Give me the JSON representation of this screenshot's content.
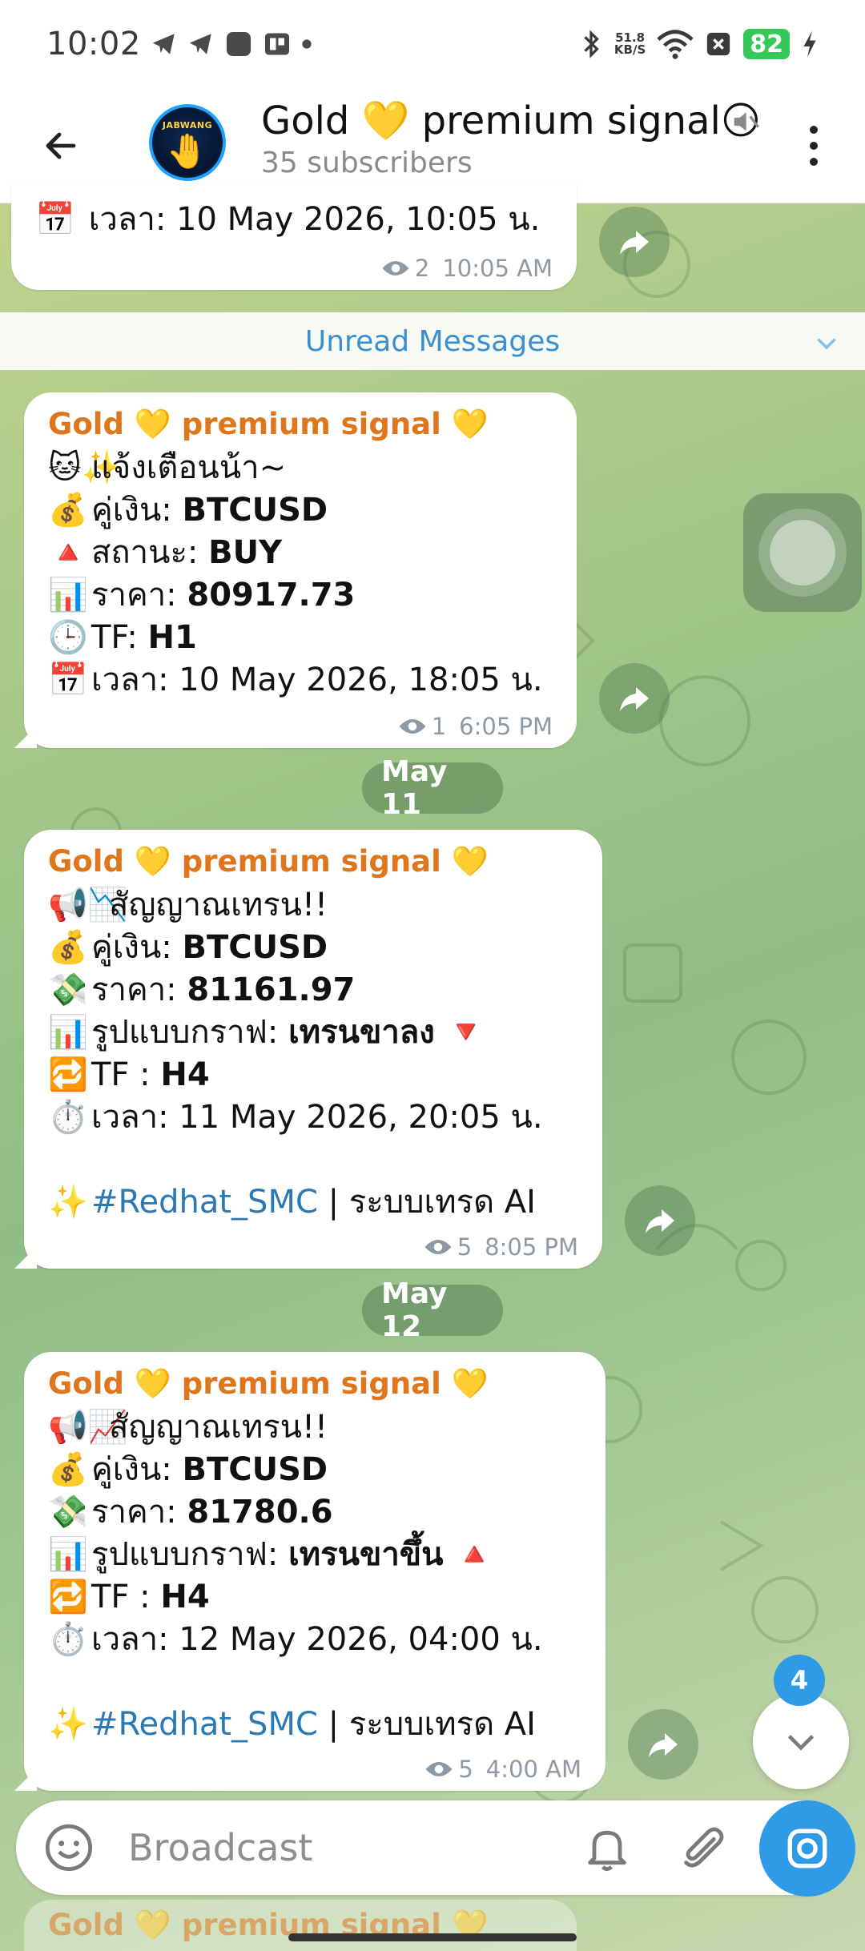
{
  "status_bar": {
    "time": "10:02",
    "net_speed_value": "51.8",
    "net_speed_unit": "KB/S",
    "battery": "82",
    "icons": [
      "telegram-icon",
      "telegram-icon",
      "app-icon",
      "app-icon",
      "dot-icon",
      "bluetooth-icon",
      "wifi-icon",
      "close-box-icon",
      "charging-icon"
    ]
  },
  "header": {
    "title": "Gold 💛 premium signal🌕",
    "subtitle": "35 subscribers",
    "avatar_text": "JABWANG",
    "avatar_emoji": "🤚"
  },
  "top_message": {
    "line_emoji": "📅",
    "line_label": "เวลา:",
    "line_value": "10 May 2026, 10:05 น.",
    "views": "2",
    "time": "10:05 AM"
  },
  "unread_label": "Unread Messages",
  "messages": [
    {
      "sender": "Gold 💛 premium signal 💛",
      "lines": [
        {
          "emoji": "🐱✨",
          "label": "แจ้งเตือนน้า~",
          "value": ""
        },
        {
          "emoji": "💰",
          "label": "คู่เงิน:",
          "value": "BTCUSD"
        },
        {
          "emoji": "🔺",
          "label": "สถานะ:",
          "value": "BUY"
        },
        {
          "emoji": "📊",
          "label": "ราคา:",
          "value": "80917.73"
        },
        {
          "emoji": "🕒",
          "label": "TF:",
          "value": "H1"
        },
        {
          "emoji": "📅",
          "label": "เวลา: 10 May 2026, 18:05 น.",
          "value": ""
        }
      ],
      "views": "1",
      "time": "6:05 PM"
    },
    {
      "date": "May 11",
      "sender": "Gold 💛 premium signal 💛",
      "lines": [
        {
          "emoji": "📢📉",
          "label": "สัญญาณเทรน!!",
          "value": ""
        },
        {
          "emoji": "💰",
          "label": "คู่เงิน:",
          "value": "BTCUSD"
        },
        {
          "emoji": "💸",
          "label": "ราคา:",
          "value": "81161.97"
        },
        {
          "emoji": "📊",
          "label": "รูปแบบกราฟ:",
          "value": "เทรนขาลง 🔻"
        },
        {
          "emoji": "🔁",
          "label": "TF :",
          "value": "H4"
        },
        {
          "emoji": "⏱️",
          "label": "เวลา: 11 May 2026, 20:05 น.",
          "value": ""
        }
      ],
      "hashtag": "#Redhat_SMC",
      "footer_text": "| ระบบเทรด AI",
      "footer_emoji": "✨",
      "views": "5",
      "time": "8:05 PM"
    },
    {
      "date": "May 12",
      "sender": "Gold 💛 premium signal 💛",
      "lines": [
        {
          "emoji": "📢📈",
          "label": "สัญญาณเทรน!!",
          "value": ""
        },
        {
          "emoji": "💰",
          "label": "คู่เงิน:",
          "value": "BTCUSD"
        },
        {
          "emoji": "💸",
          "label": "ราคา:",
          "value": "81780.6"
        },
        {
          "emoji": "📊",
          "label": "รูปแบบกราฟ:",
          "value": "เทรนขาขึ้น 🔺"
        },
        {
          "emoji": "🔁",
          "label": "TF :",
          "value": "H4"
        },
        {
          "emoji": "⏱️",
          "label": "เวลา: 12 May 2026, 04:00 น.",
          "value": ""
        }
      ],
      "hashtag": "#Redhat_SMC",
      "footer_text": "| ระบบเทรด AI",
      "footer_emoji": "✨",
      "views": "5",
      "time": "4:00 AM"
    }
  ],
  "scroll_down_badge": "4",
  "composer": {
    "placeholder": "Broadcast"
  },
  "peek_message": {
    "sender": "Gold 💛 premium signal 💛"
  },
  "colors": {
    "sender": "#e0761b",
    "hashtag": "#2a78b4",
    "accent": "#2f9be6",
    "unread_text": "#3a8fd0",
    "battery": "#34c759"
  }
}
